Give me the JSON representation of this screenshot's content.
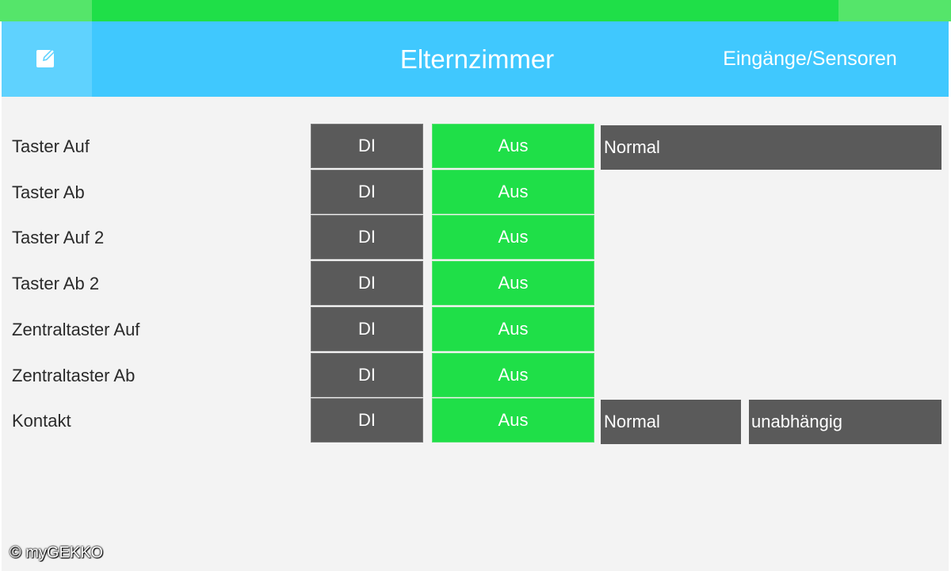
{
  "header": {
    "title": "Elternzimmer",
    "section": "Eingänge/Sensoren"
  },
  "rows": [
    {
      "label": "Taster Auf",
      "type": "DI",
      "state": "Aus",
      "mode": "Normal"
    },
    {
      "label": "Taster Ab",
      "type": "DI",
      "state": "Aus"
    },
    {
      "label": "Taster Auf 2",
      "type": "DI",
      "state": "Aus"
    },
    {
      "label": "Taster Ab 2",
      "type": "DI",
      "state": "Aus"
    },
    {
      "label": "Zentraltaster Auf",
      "type": "DI",
      "state": "Aus"
    },
    {
      "label": "Zentraltaster Ab",
      "type": "DI",
      "state": "Aus"
    },
    {
      "label": "Kontakt",
      "type": "DI",
      "state": "Aus",
      "mode": "Normal",
      "extra": "unabhängig"
    }
  ],
  "colors": {
    "top_bar": "#1fdf48",
    "header": "#40c8fe",
    "state_off": "#1fdf48",
    "cell_dark": "#5a5a5a"
  },
  "icons": {
    "edit": "edit-icon"
  },
  "copyright": "© myGEKKO"
}
